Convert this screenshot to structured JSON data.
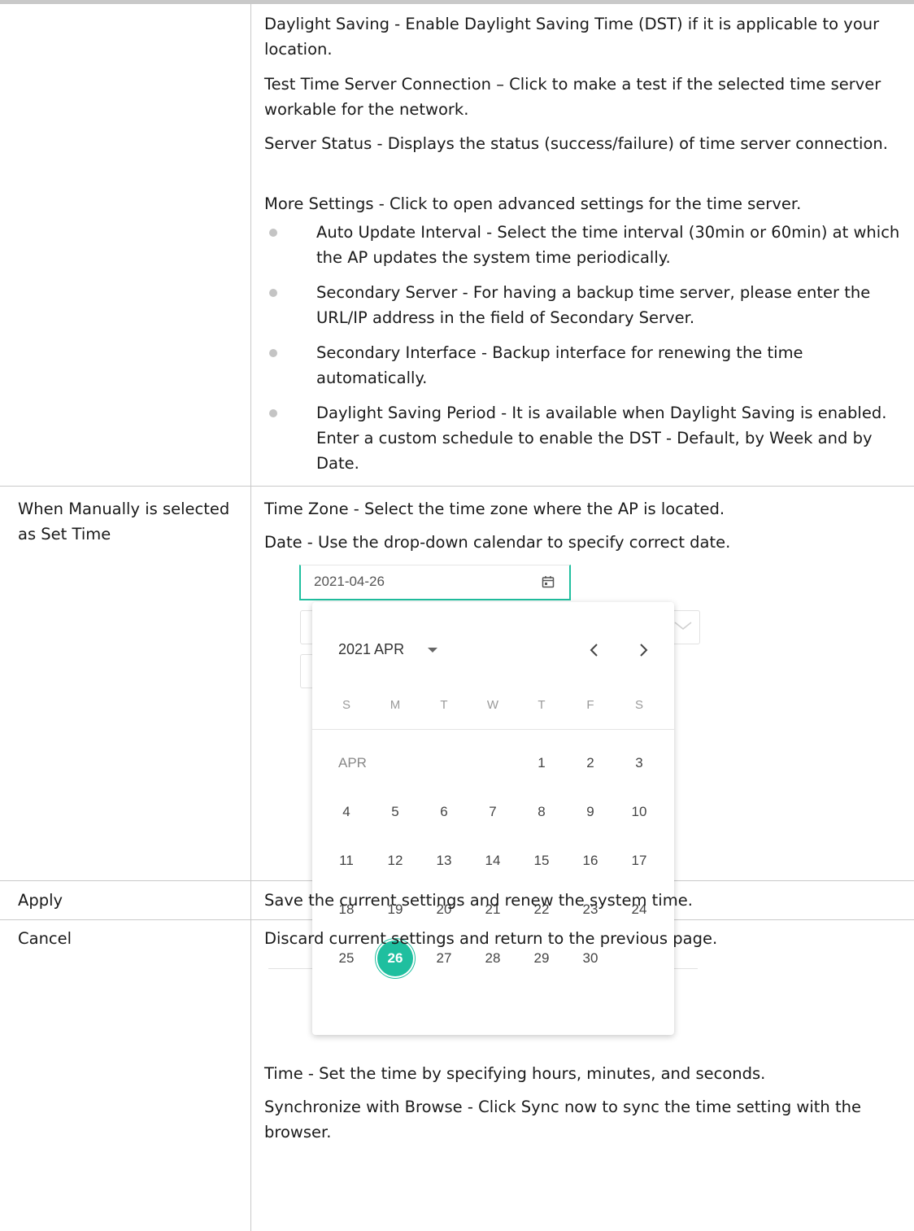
{
  "row1": {
    "paragraphs": [
      "Daylight Saving - Enable Daylight Saving Time (DST) if it is applicable to your location.",
      "Test Time Server Connection – Click to make a test if the selected time server workable for the network.",
      "Server Status - Displays the status (success/failure) of time server connection.",
      "More Settings - Click to open advanced settings for the time server."
    ],
    "bullets": [
      "Auto Update Interval - Select the time interval (30min or 60min) at which the AP updates the system time periodically.",
      "Secondary Server - For having a backup time server, please enter the URL/IP address in the field of Secondary Server.",
      "Secondary Interface - Backup interface for renewing the time automatically.",
      "Daylight Saving Period - It is available when Daylight Saving is enabled. Enter a custom schedule to enable the DST - Default, by Week and by Date."
    ]
  },
  "row2": {
    "label": "When Manually is selected as Set Time",
    "paragraphs": [
      "Time Zone - Select the time zone where the AP is located.",
      "Date - Use the drop-down calendar to specify correct date.",
      "Time - Set the time by specifying hours, minutes, and seconds.",
      "Synchronize with Browse - Click Sync now to sync the time setting with the browser."
    ],
    "date_picker": {
      "value": "2021-04-26",
      "header": "2021 APR",
      "weekdays": [
        "S",
        "M",
        "T",
        "W",
        "T",
        "F",
        "S"
      ],
      "month_label": "APR",
      "weeks": [
        [
          "",
          "",
          "",
          "",
          "1",
          "2",
          "3"
        ],
        [
          "4",
          "5",
          "6",
          "7",
          "8",
          "9",
          "10"
        ],
        [
          "11",
          "12",
          "13",
          "14",
          "15",
          "16",
          "17"
        ],
        [
          "18",
          "19",
          "20",
          "21",
          "22",
          "23",
          "24"
        ],
        [
          "25",
          "26",
          "27",
          "28",
          "29",
          "30",
          ""
        ]
      ],
      "selected_day": "26",
      "accent_color": "#1fbf9f",
      "icons": {
        "calendar": "calendar-icon",
        "prev": "chevron-left-icon",
        "next": "chevron-right-icon",
        "dropdown": "caret-down-icon"
      }
    }
  },
  "row3": {
    "label": "Apply",
    "description": "Save the current settings and renew the system time."
  },
  "row4": {
    "label": "Cancel",
    "description": "Discard current settings and return to the previous page."
  }
}
